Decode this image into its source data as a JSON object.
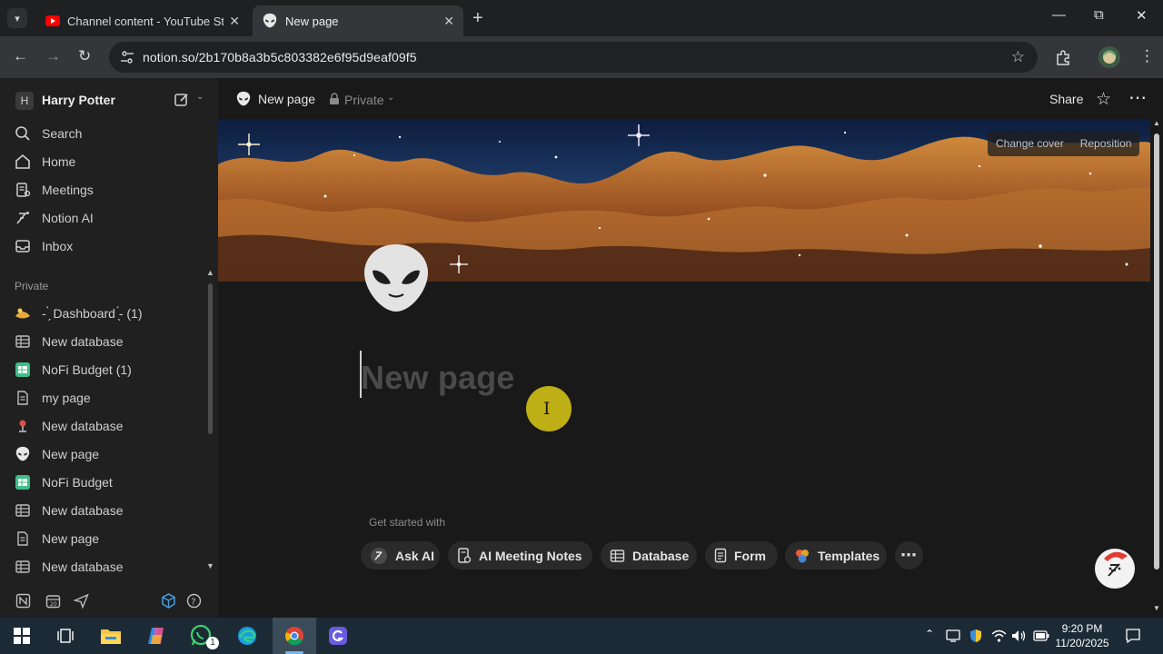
{
  "browser": {
    "tabs": [
      {
        "title": "Channel content - YouTube Stu",
        "active": false
      },
      {
        "title": "New page",
        "active": true
      }
    ],
    "url": "notion.so/2b170b8a3b5c803382e6f95d9eaf09f5"
  },
  "sidebar": {
    "workspace_initial": "H",
    "workspace_name": "Harry Potter",
    "nav": [
      {
        "label": "Search",
        "icon": "search-icon"
      },
      {
        "label": "Home",
        "icon": "home-icon"
      },
      {
        "label": "Meetings",
        "icon": "meetings-icon"
      },
      {
        "label": "Notion AI",
        "icon": "notion-ai-icon"
      },
      {
        "label": "Inbox",
        "icon": "inbox-icon"
      }
    ],
    "section_label": "Private",
    "pages": [
      {
        "label": "- ̗̀ Dashboard  ̖́- (1)",
        "icon": "emoji-icon"
      },
      {
        "label": "New database",
        "icon": "table-icon"
      },
      {
        "label": "NoFi Budget (1)",
        "icon": "spreadsheet-icon"
      },
      {
        "label": "my page",
        "icon": "page-icon"
      },
      {
        "label": "New database",
        "icon": "pin-icon"
      },
      {
        "label": "New page",
        "icon": "alien-icon"
      },
      {
        "label": "NoFi Budget",
        "icon": "spreadsheet-icon"
      },
      {
        "label": "New database",
        "icon": "table-icon"
      },
      {
        "label": "New page",
        "icon": "page-icon"
      },
      {
        "label": "New database",
        "icon": "table-icon"
      }
    ]
  },
  "topbar": {
    "page_title": "New page",
    "privacy": "Private",
    "share_label": "Share"
  },
  "cover": {
    "change_label": "Change cover",
    "reposition_label": "Reposition"
  },
  "page": {
    "title_placeholder": "New page",
    "get_started_label": "Get started with",
    "chips": [
      {
        "label": "Ask AI",
        "icon": "notion-ai-icon"
      },
      {
        "label": "AI Meeting Notes",
        "icon": "meeting-notes-icon"
      },
      {
        "label": "Database",
        "icon": "table-icon"
      },
      {
        "label": "Form",
        "icon": "form-icon"
      },
      {
        "label": "Templates",
        "icon": "templates-icon"
      }
    ]
  },
  "taskbar": {
    "time": "9:20 PM",
    "date": "11/20/2025",
    "whatsapp_badge": "1"
  },
  "colors": {
    "browser_bg": "#1f2022",
    "sidebar_bg": "#202020",
    "page_bg": "#191919",
    "taskbar_bg": "#1c2a36",
    "cursor_highlight": "#c8b716"
  }
}
